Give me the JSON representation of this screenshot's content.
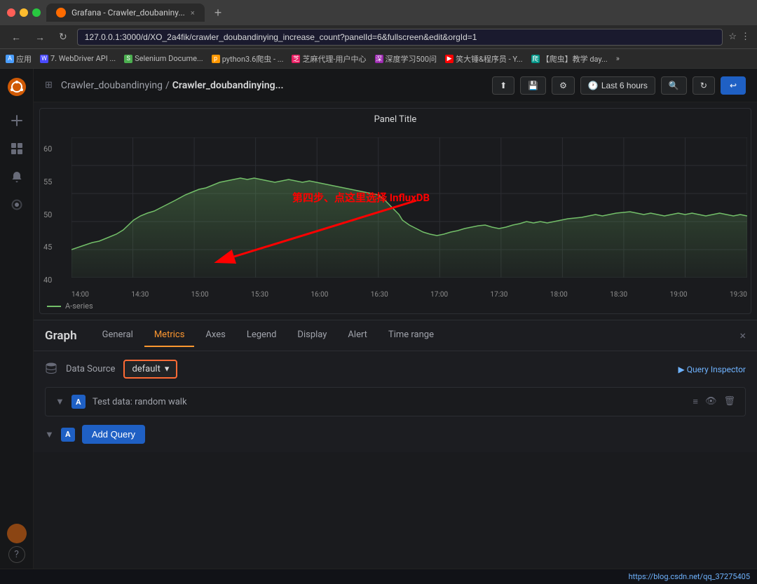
{
  "browser": {
    "tab_favicon": "G",
    "tab_title": "Grafana - Crawler_doubaniny...",
    "new_tab_label": "+",
    "address": "127.0.0.1:3000/d/XO_2a4fik/crawler_doubandinying_increase_count?panelId=6&fullscreen&edit&orgId=1",
    "nav_back": "←",
    "nav_forward": "→",
    "nav_refresh": "↻"
  },
  "bookmarks": [
    {
      "label": "应用"
    },
    {
      "label": "7. WebDriver API ..."
    },
    {
      "label": "Selenium Docume..."
    },
    {
      "label": "python3.6爬虫 - ..."
    },
    {
      "label": "芝麻代理-用户中心"
    },
    {
      "label": "深度学习500问"
    },
    {
      "label": "笑大锤&程序员 - Y..."
    },
    {
      "label": "【爬虫】教学 day..."
    },
    {
      "label": "»"
    }
  ],
  "header": {
    "breadcrumb_parent": "Crawler_doubandinying",
    "breadcrumb_separator": "/",
    "breadcrumb_current": "Crawler_doubandinying...",
    "share_label": "⬆",
    "save_label": "💾",
    "settings_label": "⚙",
    "time_range_label": "Last 6 hours",
    "search_label": "🔍",
    "refresh_label": "↻",
    "back_label": "↩"
  },
  "chart": {
    "title": "Panel Title",
    "y_axis_labels": [
      "60",
      "55",
      "50",
      "45",
      "40"
    ],
    "x_axis_labels": [
      "14:00",
      "14:30",
      "15:00",
      "15:30",
      "16:00",
      "16:30",
      "17:00",
      "17:30",
      "18:00",
      "18:30",
      "19:00",
      "19:30"
    ],
    "legend_label": "A-series",
    "annotation_text": "第四步、点这里选择 InfluxDB"
  },
  "editor": {
    "panel_title": "Graph",
    "tabs": [
      {
        "label": "General",
        "active": false
      },
      {
        "label": "Metrics",
        "active": true
      },
      {
        "label": "Axes",
        "active": false
      },
      {
        "label": "Legend",
        "active": false
      },
      {
        "label": "Display",
        "active": false
      },
      {
        "label": "Alert",
        "active": false
      },
      {
        "label": "Time range",
        "active": false
      }
    ],
    "close_label": "×",
    "datasource": {
      "label": "Data Source",
      "value": "default",
      "dropdown_icon": "▾"
    },
    "query_inspector_label": "▶ Query Inspector",
    "queries": [
      {
        "letter": "A",
        "text": "Test data: random walk",
        "actions": [
          "≡",
          "👁",
          "🗑"
        ]
      }
    ],
    "add_query": {
      "letter": "A",
      "label": "Add Query"
    }
  },
  "status_bar": {
    "url": "https://blog.csdn.net/qq_37275405"
  },
  "sidebar": {
    "logo_icon": "flame",
    "items": [
      {
        "label": "plus",
        "icon": "+"
      },
      {
        "label": "apps",
        "icon": "⊞"
      },
      {
        "label": "bell",
        "icon": "🔔"
      },
      {
        "label": "gear",
        "icon": "⚙"
      }
    ],
    "bottom_items": [
      {
        "label": "help",
        "icon": "?"
      }
    ]
  }
}
